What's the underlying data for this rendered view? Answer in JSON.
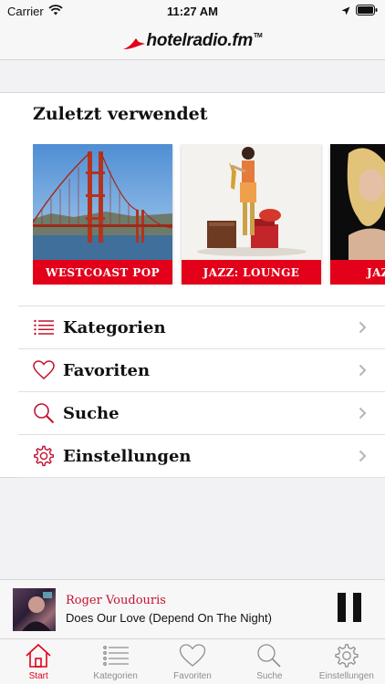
{
  "status_bar": {
    "carrier": "Carrier",
    "time": "11:27 AM"
  },
  "header": {
    "logo_text": "hotelradio.fm",
    "logo_tm": "TM"
  },
  "recent": {
    "title": "Zuletzt verwendet",
    "items": [
      {
        "label": "WESTCOAST POP"
      },
      {
        "label": "JAZZ: LOUNGE"
      },
      {
        "label": "JAZ"
      }
    ]
  },
  "menu": {
    "items": [
      {
        "label": "Kategorien",
        "icon": "list-icon"
      },
      {
        "label": "Favoriten",
        "icon": "heart-icon"
      },
      {
        "label": "Suche",
        "icon": "search-icon"
      },
      {
        "label": "Einstellungen",
        "icon": "gear-icon"
      }
    ]
  },
  "player": {
    "artist": "Roger Voudouris",
    "track": "Does Our Love (Depend On The Night)"
  },
  "tabs": [
    {
      "label": "Start",
      "active": true
    },
    {
      "label": "Kategorien"
    },
    {
      "label": "Favoriten"
    },
    {
      "label": "Suche"
    },
    {
      "label": "Einstellungen"
    }
  ],
  "colors": {
    "accent": "#e2001a",
    "tab_inactive": "#8e8e93"
  }
}
